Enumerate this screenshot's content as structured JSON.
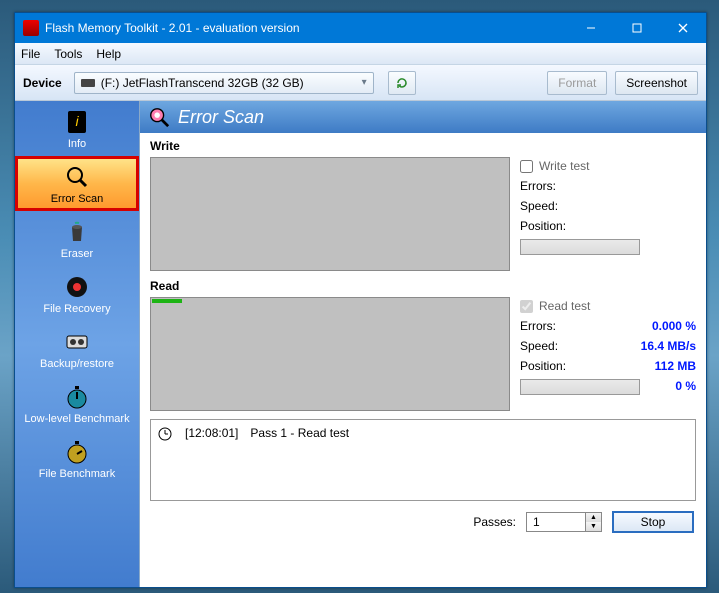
{
  "title": "Flash Memory Toolkit - 2.01 - evaluation version",
  "menu": {
    "file": "File",
    "tools": "Tools",
    "help": "Help"
  },
  "toolbar": {
    "device_label": "Device",
    "device_value": "(F:) JetFlashTranscend 32GB (32 GB)",
    "format": "Format",
    "screenshot": "Screenshot"
  },
  "sidebar": {
    "items": [
      {
        "label": "Info"
      },
      {
        "label": "Error Scan"
      },
      {
        "label": "Eraser"
      },
      {
        "label": "File Recovery"
      },
      {
        "label": "Backup/restore"
      },
      {
        "label": "Low-level Benchmark"
      },
      {
        "label": "File Benchmark"
      }
    ]
  },
  "panel": {
    "title": "Error Scan"
  },
  "write": {
    "heading": "Write",
    "check_label": "Write test",
    "checked": false,
    "errors_label": "Errors:",
    "errors_value": "",
    "speed_label": "Speed:",
    "speed_value": "",
    "position_label": "Position:",
    "position_value": ""
  },
  "read": {
    "heading": "Read",
    "check_label": "Read test",
    "checked": true,
    "errors_label": "Errors:",
    "errors_value": "0.000 %",
    "speed_label": "Speed:",
    "speed_value": "16.4 MB/s",
    "position_label": "Position:",
    "position_value": "112 MB",
    "progress_value": "0 %"
  },
  "log": {
    "time": "[12:08:01]",
    "text": "Pass 1 - Read test"
  },
  "bottom": {
    "passes_label": "Passes:",
    "passes_value": "1",
    "stop": "Stop"
  }
}
